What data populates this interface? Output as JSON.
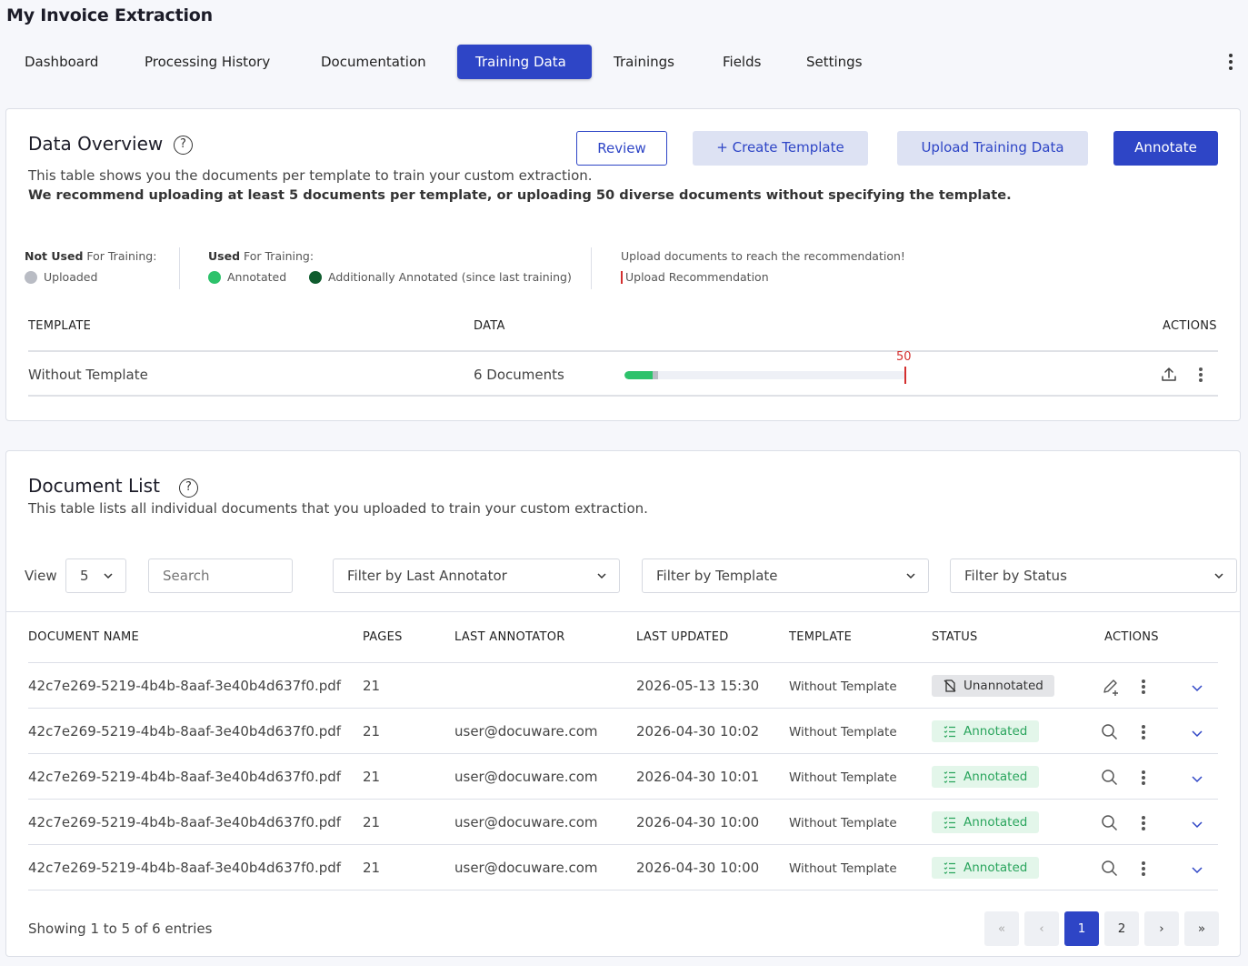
{
  "app": {
    "title": "My Invoice Extraction"
  },
  "nav": {
    "tabs": [
      {
        "label": "Dashboard",
        "active": false
      },
      {
        "label": "Processing History",
        "active": false
      },
      {
        "label": "Documentation",
        "active": false
      },
      {
        "label": "Training Data",
        "active": true
      },
      {
        "label": "Trainings",
        "active": false
      },
      {
        "label": "Fields",
        "active": false
      },
      {
        "label": "Settings",
        "active": false
      }
    ],
    "more_icon": "more-vertical-icon"
  },
  "overview": {
    "title": "Data Overview",
    "help_glyph": "?",
    "description": "This table shows you the documents per template to train your custom extraction.",
    "recommendation": "We recommend uploading at least 5 documents per template, or uploading 50 diverse documents without specifying the template.",
    "buttons": {
      "review": "Review",
      "create_template": "+  Create Template",
      "upload": "Upload Training Data",
      "annotate": "Annotate"
    },
    "legend": {
      "not_used_strong": "Not Used",
      "not_used_rest": " For Training:",
      "uploaded": "Uploaded",
      "used_strong": "Used",
      "used_rest": " For Training:",
      "annotated": "Annotated",
      "additionally_annotated": "Additionally Annotated (since last training)",
      "upload_hint": "Upload documents to reach the recommendation!",
      "upload_recommendation": "Upload Recommendation"
    },
    "colors": {
      "uploaded": "#b9bcc4",
      "annotated": "#2dc26b",
      "additionally_annotated": "#0f5c2e",
      "recommendation": "#d32f2f",
      "accent": "#2e45c6"
    },
    "table": {
      "headers": {
        "template": "TEMPLATE",
        "data": "DATA",
        "actions": "ACTIONS"
      },
      "row": {
        "template": "Without Template",
        "data": "6 Documents",
        "recommendation_value": "50",
        "recommendation_max": 50,
        "annotated_count": 5,
        "uploaded_count": 1,
        "icons": [
          "upload-icon",
          "more-vertical-icon"
        ]
      }
    }
  },
  "doclist": {
    "title": "Document List",
    "help_glyph": "?",
    "description": "This table lists all individual documents that you uploaded to train your custom extraction.",
    "controls": {
      "view_label": "View",
      "view_value": "5",
      "search_placeholder": "Search",
      "filter_annotator": "Filter by Last Annotator",
      "filter_template": "Filter by Template",
      "filter_status": "Filter by Status"
    },
    "headers": {
      "name": "DOCUMENT NAME",
      "pages": "PAGES",
      "annotator": "LAST ANNOTATOR",
      "updated": "LAST UPDATED",
      "template": "TEMPLATE",
      "status": "STATUS",
      "actions": "ACTIONS"
    },
    "rows": [
      {
        "name": "42c7e269-5219-4b4b-8aaf-3e40b4d637f0.pdf",
        "pages": "21",
        "annotator": "",
        "updated": "2026-05-13 15:30",
        "template": "Without Template",
        "status": "Unannotated",
        "action_icon": "edit-annotate-icon"
      },
      {
        "name": "42c7e269-5219-4b4b-8aaf-3e40b4d637f0.pdf",
        "pages": "21",
        "annotator": "user@docuware.com",
        "updated": "2026-04-30 10:02",
        "template": "Without Template",
        "status": "Annotated",
        "action_icon": "search-icon"
      },
      {
        "name": "42c7e269-5219-4b4b-8aaf-3e40b4d637f0.pdf",
        "pages": "21",
        "annotator": "user@docuware.com",
        "updated": "2026-04-30 10:01",
        "template": "Without Template",
        "status": "Annotated",
        "action_icon": "search-icon"
      },
      {
        "name": "42c7e269-5219-4b4b-8aaf-3e40b4d637f0.pdf",
        "pages": "21",
        "annotator": "user@docuware.com",
        "updated": "2026-04-30 10:00",
        "template": "Without Template",
        "status": "Annotated",
        "action_icon": "search-icon"
      },
      {
        "name": "42c7e269-5219-4b4b-8aaf-3e40b4d637f0.pdf",
        "pages": "21",
        "annotator": "user@docuware.com",
        "updated": "2026-04-30 10:00",
        "template": "Without Template",
        "status": "Annotated",
        "action_icon": "search-icon"
      }
    ],
    "footer": {
      "showing": "Showing 1 to 5 of 6 entries",
      "pagination": {
        "first": "«",
        "prev": "‹",
        "pages": [
          "1",
          "2"
        ],
        "current": "1",
        "next": "›",
        "last": "»"
      }
    }
  }
}
